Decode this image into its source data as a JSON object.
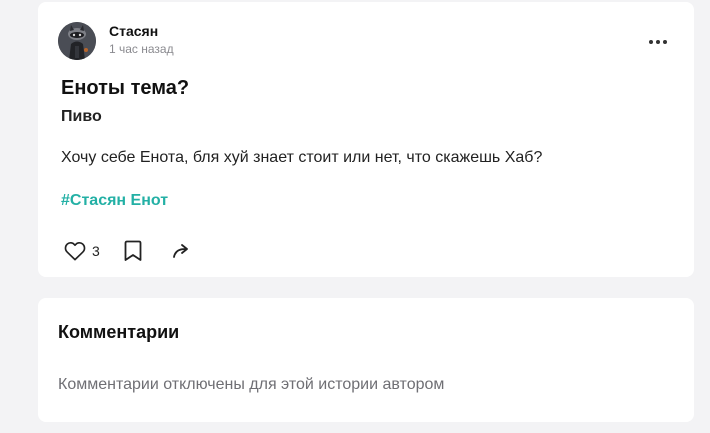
{
  "post": {
    "author": {
      "name": "Стасян",
      "time": "1 час назад",
      "avatar_icon": "raccoon-avatar"
    },
    "menu_icon": "more-horizontal-icon",
    "title": "Еноты тема?",
    "subtitle": "Пиво",
    "body": "Хочу себе Енота, бля хуй знает стоит или нет, что скажешь Хаб?",
    "tag": "#Стасян Енот",
    "tag_color": "#23b0a5",
    "actions": {
      "like_icon": "heart-icon",
      "like_count": "3",
      "save_icon": "bookmark-icon",
      "share_icon": "share-icon"
    }
  },
  "comments": {
    "title": "Комментарии",
    "note": "Комментарии отключены для этой истории автором"
  },
  "colors": {
    "background": "#f3f3f5",
    "card": "#ffffff",
    "accent": "#23b0a5"
  }
}
